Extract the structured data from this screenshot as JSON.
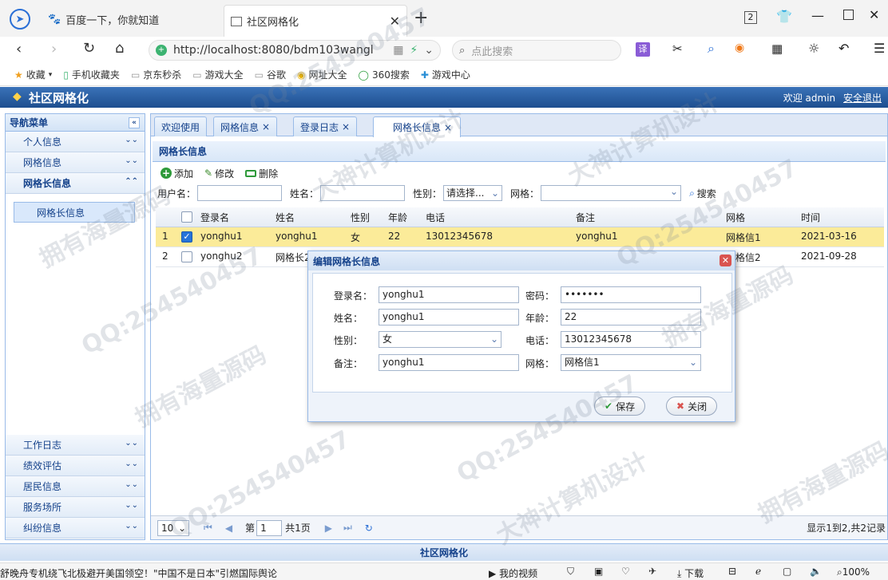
{
  "browser": {
    "tabs": [
      {
        "title": "百度一下，你就知道"
      },
      {
        "title": "社区网格化"
      }
    ],
    "tab_count": "2",
    "url": "http://localhost:8080/bdm103wangl",
    "search_placeholder": "点此搜索",
    "bookmarks": [
      "收藏",
      "手机收藏夹",
      "京东秒杀",
      "游戏大全",
      "谷歌",
      "网址大全",
      "360搜索",
      "游戏中心"
    ]
  },
  "app": {
    "title": "社区网格化",
    "welcome": "欢迎 admin",
    "logout": "安全退出",
    "footer": "社区网格化"
  },
  "nav": {
    "header": "导航菜单",
    "top_items": [
      "个人信息",
      "网格信息",
      "网格长信息"
    ],
    "sub_item": "网格长信息",
    "bottom_items": [
      "工作日志",
      "绩效评估",
      "居民信息",
      "服务场所",
      "纠纷信息"
    ]
  },
  "tabs": [
    "欢迎使用",
    "网格信息",
    "登录日志",
    "网格长信息"
  ],
  "panel": {
    "title": "网格长信息",
    "add": "添加",
    "edit": "修改",
    "delete": "删除",
    "q_username": "用户名：",
    "q_name": "姓名：",
    "q_gender": "性别：",
    "q_gender_value": "请选择...",
    "q_grid": "网格：",
    "search": "搜索"
  },
  "table": {
    "headers": [
      "登录名",
      "姓名",
      "性别",
      "年龄",
      "电话",
      "备注",
      "网格",
      "时间"
    ],
    "rows": [
      {
        "no": "1",
        "login": "yonghu1",
        "name": "yonghu1",
        "gender": "女",
        "age": "22",
        "phone": "13012345678",
        "remark": "yonghu1",
        "grid": "网格信1",
        "time": "2021-03-16"
      },
      {
        "no": "2",
        "login": "yonghu2",
        "name": "网格长2",
        "gender": "",
        "age": "",
        "phone": "",
        "remark": "",
        "grid": "格信2",
        "time": "2021-09-28"
      }
    ]
  },
  "pager": {
    "size": "10",
    "page_prefix": "第",
    "page": "1",
    "page_suffix": "共1页",
    "info": "显示1到2,共2记录"
  },
  "dialog": {
    "title": "编辑网格长信息",
    "l_login": "登录名：",
    "v_login": "yonghu1",
    "l_pwd": "密码：",
    "v_pwd": "•••••••",
    "l_name": "姓名：",
    "v_name": "yonghu1",
    "l_age": "年龄：",
    "v_age": "22",
    "l_gender": "性别：",
    "v_gender": "女",
    "l_phone": "电话：",
    "v_phone": "13012345678",
    "l_remark": "备注：",
    "v_remark": "yonghu1",
    "l_grid": "网格：",
    "v_grid": "网格信1",
    "save": "保存",
    "close": "关闭"
  },
  "statusbar": {
    "news": "舒晚舟专机绕飞北极避开美国领空！\"中国不是日本\"引燃国际舆论",
    "video": "我的视频",
    "download": "下载",
    "zoom": "100%"
  },
  "watermarks": [
    "QQ:254540457",
    "拥有海量源码",
    "大神计算机设计"
  ]
}
